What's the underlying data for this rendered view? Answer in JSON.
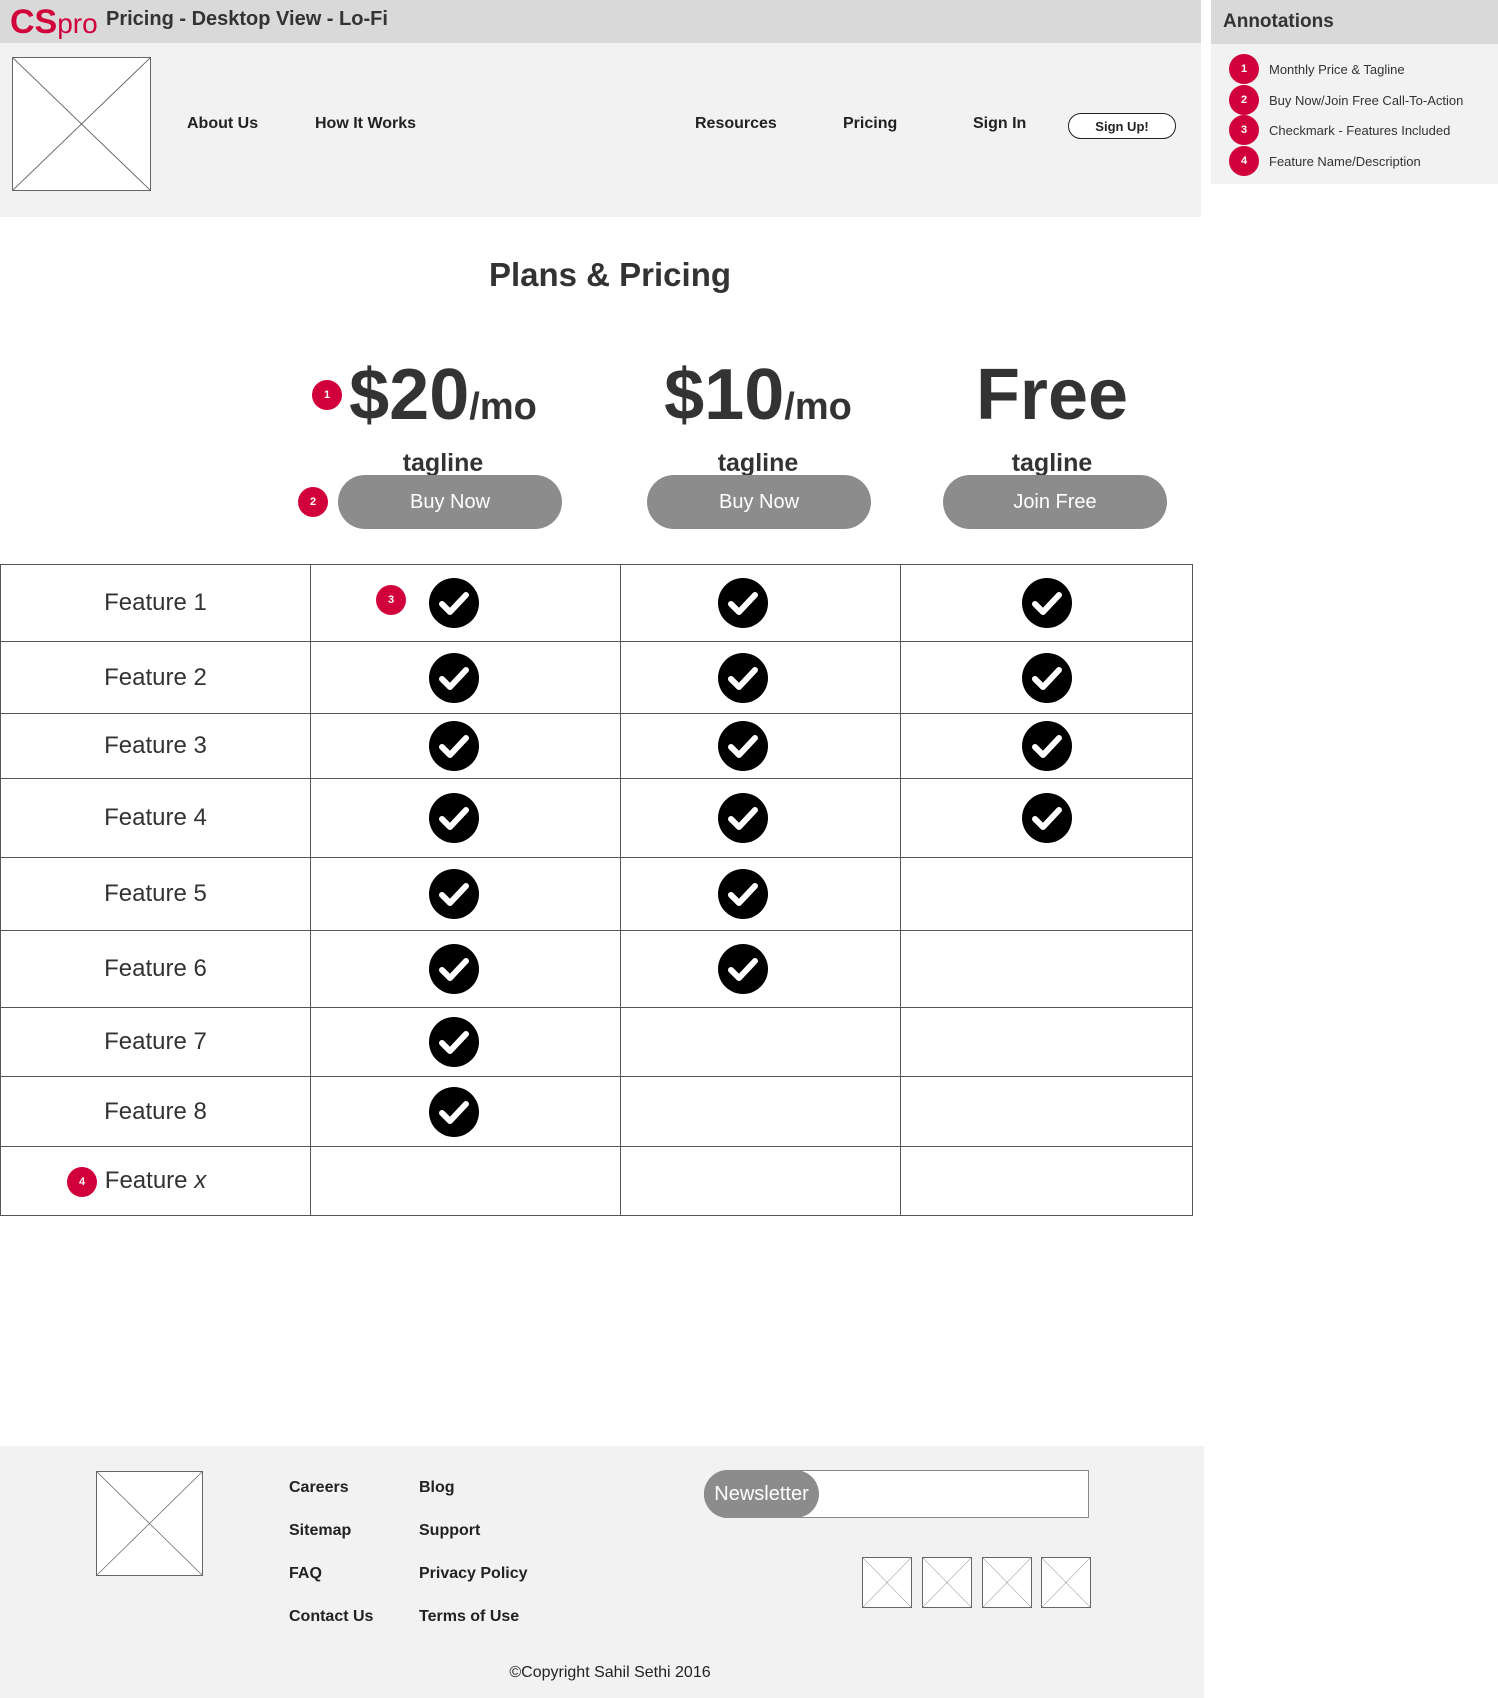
{
  "title_bar": {
    "brand_cs": "CS",
    "brand_pro": "pro",
    "page_title": "Pricing - Desktop View - Lo-Fi"
  },
  "nav": {
    "about": "About Us",
    "how_it_works": "How It Works",
    "resources": "Resources",
    "pricing": "Pricing",
    "sign_in": "Sign In",
    "sign_up": "Sign Up!"
  },
  "annotations": {
    "title": "Annotations",
    "items": [
      {
        "num": "1",
        "text": "Monthly Price & Tagline"
      },
      {
        "num": "2",
        "text": "Buy Now/Join Free Call-To-Action"
      },
      {
        "num": "3",
        "text": "Checkmark - Features Included"
      },
      {
        "num": "4",
        "text": "Feature Name/Description"
      }
    ]
  },
  "main": {
    "title": "Plans & Pricing",
    "plans": [
      {
        "price": "$20",
        "period": "/mo",
        "tagline": "tagline",
        "cta": "Buy Now"
      },
      {
        "price": "$10",
        "period": "/mo",
        "tagline": "tagline",
        "cta": "Buy Now"
      },
      {
        "price": "Free",
        "period": "",
        "tagline": "tagline",
        "cta": "Join Free"
      }
    ]
  },
  "features": [
    {
      "name": "Feature 1",
      "included": [
        true,
        true,
        true
      ]
    },
    {
      "name": "Feature 2",
      "included": [
        true,
        true,
        true
      ]
    },
    {
      "name": "Feature 3",
      "included": [
        true,
        true,
        true
      ]
    },
    {
      "name": "Feature 4",
      "included": [
        true,
        true,
        true
      ]
    },
    {
      "name": "Feature 5",
      "included": [
        true,
        true,
        false
      ]
    },
    {
      "name": "Feature 6",
      "included": [
        true,
        true,
        false
      ]
    },
    {
      "name": "Feature 7",
      "included": [
        true,
        false,
        false
      ]
    },
    {
      "name": "Feature 8",
      "included": [
        true,
        false,
        false
      ]
    },
    {
      "name": "Feature x",
      "included": [
        false,
        false,
        false
      ]
    }
  ],
  "footer": {
    "col1": [
      "Careers",
      "Sitemap",
      "FAQ",
      "Contact Us"
    ],
    "col2": [
      "Blog",
      "Support",
      "Privacy Policy",
      "Terms of Use"
    ],
    "newsletter": "Newsletter",
    "copyright": "©Copyright Sahil Sethi 2016"
  },
  "colors": {
    "accent": "#d1003a",
    "button_gray": "#8c8c8c",
    "panel_gray": "#f2f2f2",
    "bar_gray": "#d9d9d9"
  }
}
